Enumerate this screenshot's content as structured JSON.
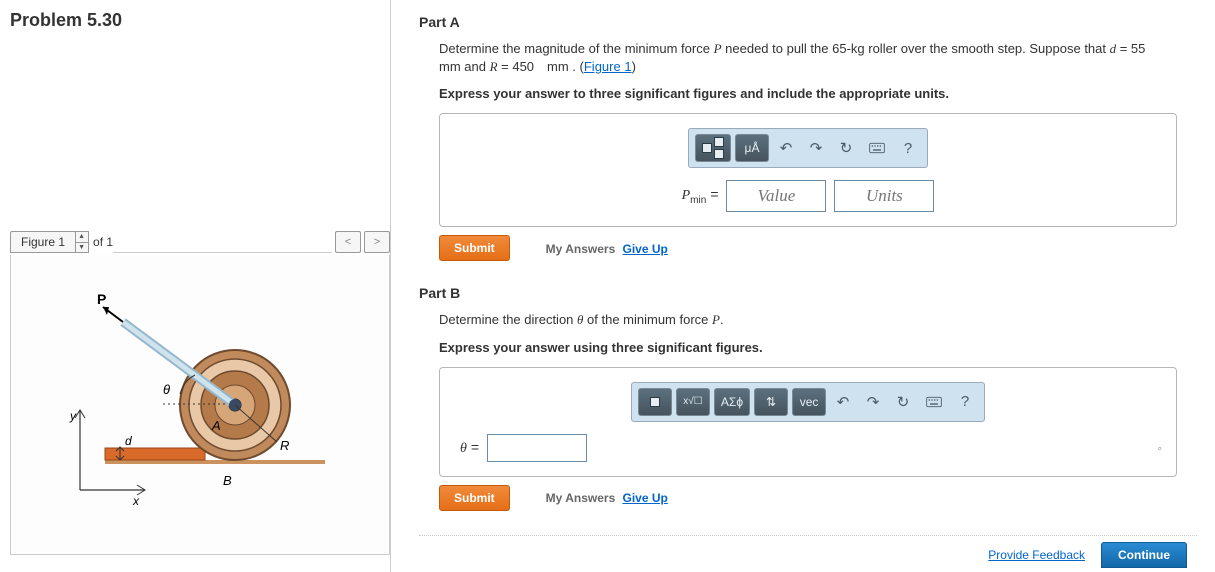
{
  "problem_title": "Problem 5.30",
  "figure": {
    "tab_label": "Figure 1",
    "of_label": "of 1",
    "prev": "<",
    "next": ">"
  },
  "partA": {
    "title": "Part A",
    "desc_pre": "Determine the magnitude of the minimum force ",
    "desc_var1": "P",
    "desc_mid1": " needed to pull the 65-kg roller over the smooth step. Suppose that ",
    "desc_var2": "d",
    "desc_mid2": " = 55 mm and ",
    "desc_var3": "R",
    "desc_mid3": " = 450 mm . (",
    "figure_link": "Figure 1",
    "desc_end": ")",
    "instruction": "Express your answer to three significant figures and include the appropriate units.",
    "toolbar": {
      "mu": "μÅ"
    },
    "answer_label_var": "P",
    "answer_label_sub": "min",
    "answer_label_eq": " = ",
    "value_ph": "Value",
    "units_ph": "Units",
    "submit": "Submit",
    "my_answers": "My Answers",
    "give_up": "Give Up"
  },
  "partB": {
    "title": "Part B",
    "desc_pre": "Determine the direction ",
    "desc_var1": "θ",
    "desc_mid1": " of the minimum force ",
    "desc_var2": "P",
    "desc_end": ".",
    "instruction": "Express your answer using three significant figures.",
    "toolbar": {
      "greek": "ΑΣϕ",
      "updown": "⇅",
      "vec": "vec"
    },
    "answer_label_var": "θ",
    "answer_label_eq": " = ",
    "submit": "Submit",
    "my_answers": "My Answers",
    "give_up": "Give Up",
    "degree": "°"
  },
  "footer": {
    "feedback": "Provide Feedback",
    "continue": "Continue"
  }
}
